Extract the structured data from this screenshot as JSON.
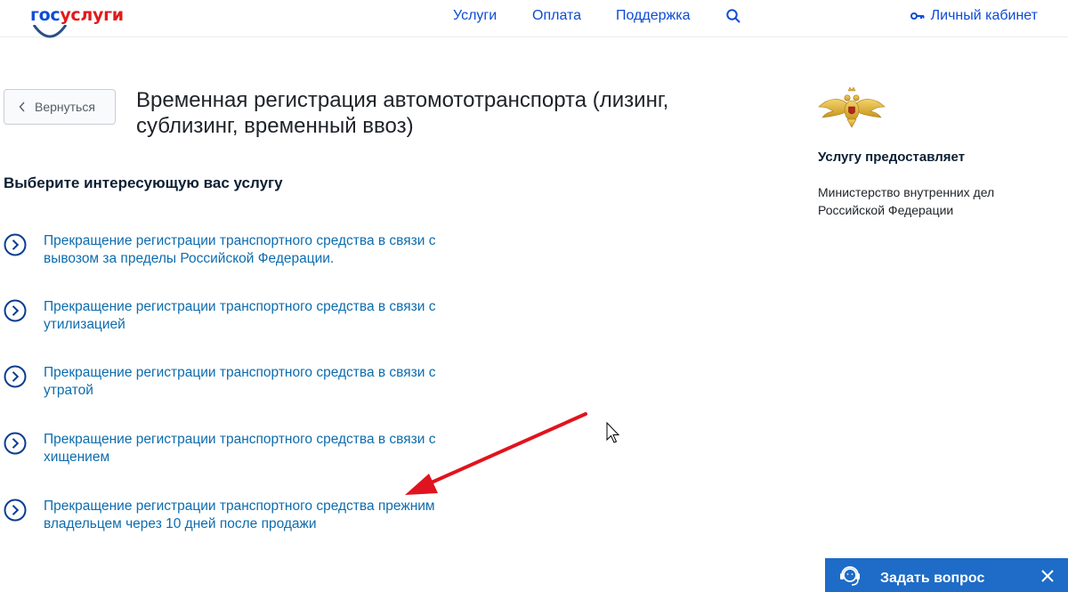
{
  "header": {
    "logo_part1": "гос",
    "logo_part2": "услуги",
    "nav": [
      {
        "label": "Услуги"
      },
      {
        "label": "Оплата"
      },
      {
        "label": "Поддержка"
      }
    ],
    "search_icon": "search-icon",
    "cabinet_label": "Личный кабинет",
    "cabinet_icon": "key-icon"
  },
  "main": {
    "back_label": "Вернуться",
    "title": "Временная регистрация автомототранспорта (лизинг, сублизинг, временный ввоз)",
    "section_heading": "Выберите интересующую вас услугу",
    "services": [
      {
        "line1": "Прекращение регистрации транспортного средства в связи с",
        "line2": "вывозом за пределы Российской Федерации."
      },
      {
        "line1": "Прекращение регистрации транспортного средства в связи с",
        "line2": "утилизацией"
      },
      {
        "line1": "Прекращение регистрации транспортного средства в связи с",
        "line2": "утратой"
      },
      {
        "line1": "Прекращение регистрации транспортного средства в связи с",
        "line2": "хищением"
      },
      {
        "line1": "Прекращение регистрации транспортного средства прежним",
        "line2": "владельцем через 10 дней после продажи"
      }
    ]
  },
  "sidebar": {
    "provider_heading": "Услугу предоставляет",
    "provider_name": "Министерство внутренних дел Российской Федерации",
    "emblem_icon": "double-headed-eagle-emblem"
  },
  "widget": {
    "ask_label": "Задать вопрос",
    "ask_icon": "headset-operator-icon",
    "close_icon": "close-icon"
  },
  "colors": {
    "brand_blue": "#0d4cd3",
    "brand_red": "#e21a1a",
    "link_blue": "#0d6cae",
    "widget_blue": "#1e6cc7",
    "annotation_red": "#e0141e"
  }
}
